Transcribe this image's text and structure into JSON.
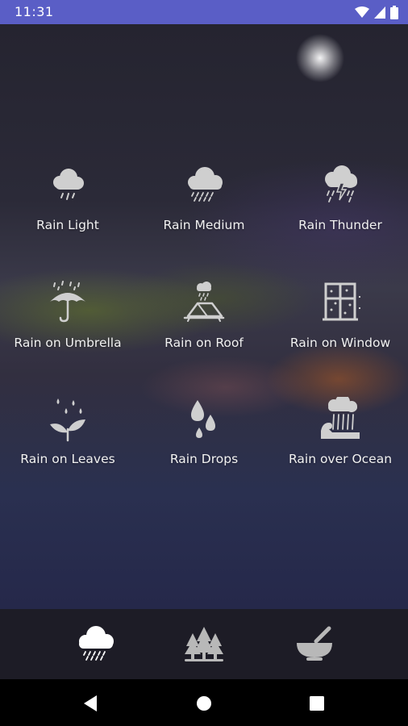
{
  "status_bar": {
    "time": "11:31",
    "icons": [
      "wifi-icon",
      "signal-icon",
      "battery-icon"
    ]
  },
  "sounds": [
    {
      "label": "Rain Light",
      "icon": "rain-light-icon"
    },
    {
      "label": "Rain Medium",
      "icon": "rain-medium-icon"
    },
    {
      "label": "Rain Thunder",
      "icon": "rain-thunder-icon"
    },
    {
      "label": "Rain on Umbrella",
      "icon": "umbrella-icon"
    },
    {
      "label": "Rain on Roof",
      "icon": "roof-icon"
    },
    {
      "label": "Rain on Window",
      "icon": "window-icon"
    },
    {
      "label": "Rain on Leaves",
      "icon": "leaves-icon"
    },
    {
      "label": "Rain Drops",
      "icon": "drops-icon"
    },
    {
      "label": "Rain over Ocean",
      "icon": "ocean-icon"
    }
  ],
  "bottom_tabs": [
    {
      "icon": "rain-cloud-icon",
      "active": true
    },
    {
      "icon": "forest-icon",
      "active": false
    },
    {
      "icon": "bowl-icon",
      "active": false
    }
  ],
  "nav_bar": [
    "back-icon",
    "home-icon",
    "recents-icon"
  ],
  "colors": {
    "status_bar": "#5a5ec6",
    "icon": "#cfcfcf",
    "label": "#f1f1f1",
    "bottom_bar": "#1d1c26"
  }
}
